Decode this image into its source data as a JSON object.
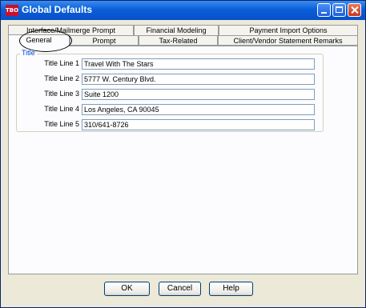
{
  "window": {
    "title": "Global Defaults",
    "app_icon_text": "TBO"
  },
  "tabs": {
    "row1": [
      {
        "label": "Interface/Mailmerge Prompt"
      },
      {
        "label": "Financial Modeling"
      },
      {
        "label": "Payment Import Options"
      }
    ],
    "row2": [
      {
        "label": "General",
        "active": true
      },
      {
        "label": "Prompt"
      },
      {
        "label": "Tax-Related"
      },
      {
        "label": "Client/Vendor Statement Remarks"
      }
    ]
  },
  "title_group": {
    "legend": "Title",
    "lines": [
      {
        "label": "Title Line 1",
        "value": "Travel With The Stars"
      },
      {
        "label": "Title Line 2",
        "value": "5777 W. Century Blvd."
      },
      {
        "label": "Title Line 3",
        "value": "Suite 1200"
      },
      {
        "label": "Title Line 4",
        "value": "Los Angeles, CA 90045"
      },
      {
        "label": "Title Line 5",
        "value": "310/641-8726"
      }
    ]
  },
  "buttons": {
    "ok": "OK",
    "cancel": "Cancel",
    "help": "Help"
  },
  "colors": {
    "titlebar": "#0a5fd8",
    "dialog_bg": "#ece9d8",
    "legend": "#0046d5"
  }
}
